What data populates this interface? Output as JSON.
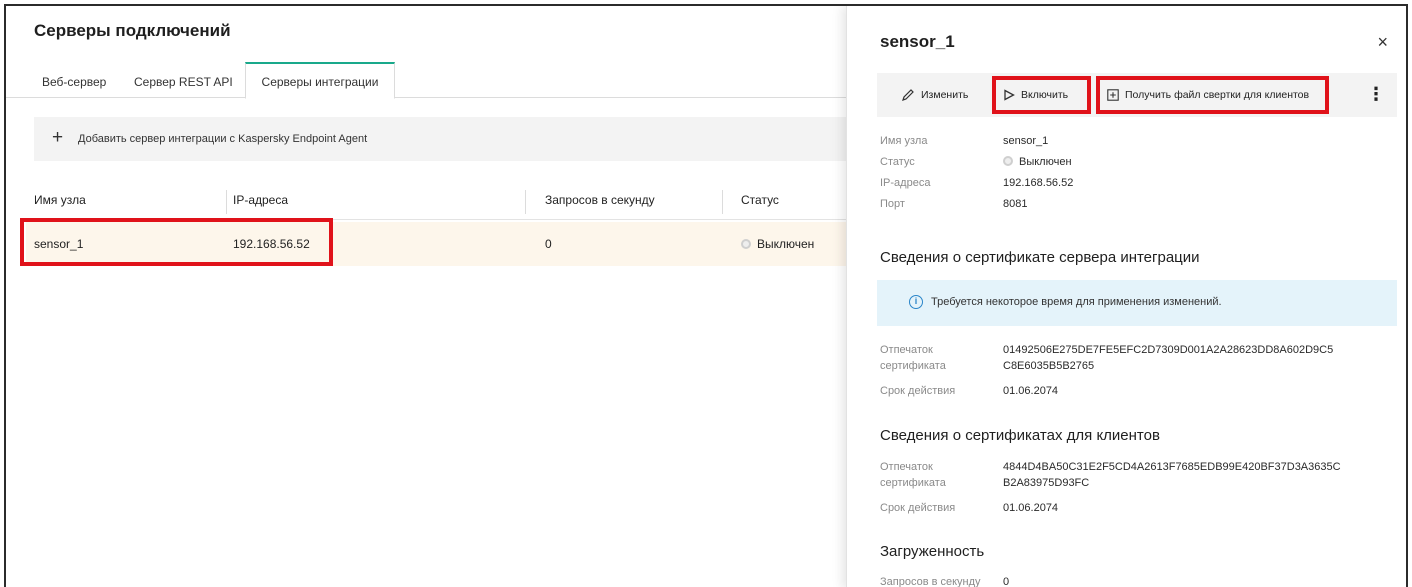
{
  "main": {
    "title": "Серверы подключений",
    "tabs": [
      {
        "label": "Веб-сервер"
      },
      {
        "label": "Сервер REST API"
      },
      {
        "label": "Серверы интеграции",
        "active": true
      }
    ],
    "add_button_label": "Добавить сервер интеграции с Kaspersky Endpoint Agent",
    "table": {
      "columns": [
        "Имя узла",
        "IP-адреса",
        "Запросов в секунду",
        "Статус"
      ],
      "rows": [
        {
          "name": "sensor_1",
          "ip": "192.168.56.52",
          "rps": "0",
          "status": "Выключен"
        }
      ]
    }
  },
  "panel": {
    "title": "sensor_1",
    "close_icon": "×",
    "toolbar": {
      "edit": "Изменить",
      "enable": "Включить",
      "get_file": "Получить файл свертки для клиентов",
      "more_icon": "⋮"
    },
    "details": {
      "host_label": "Имя узла",
      "host_value": "sensor_1",
      "status_label": "Статус",
      "status_value": "Выключен",
      "ip_label": "IP-адреса",
      "ip_value": "192.168.56.52",
      "port_label": "Порт",
      "port_value": "8081"
    },
    "server_cert": {
      "title": "Сведения о сертификате сервера интеграции",
      "info": "Требуется некоторое время для применения изменений.",
      "thumb_label_1": "Отпечаток",
      "thumb_label_2": "сертификата",
      "thumb_value_1": "01492506E275DE7FE5EFC2D7309D001A2A28623DD8A602D9C5",
      "thumb_value_2": "C8E6035B5B2765",
      "valid_label": "Срок действия",
      "valid_value": "01.06.2074"
    },
    "client_cert": {
      "title": "Сведения о сертификатах для клиентов",
      "thumb_label_1": "Отпечаток",
      "thumb_label_2": "сертификата",
      "thumb_value_1": "4844D4BA50C31E2F5CD4A2613F7685EDB99E420BF37D3A3635C",
      "thumb_value_2": "B2A83975D93FC",
      "valid_label": "Срок действия",
      "valid_value": "01.06.2074"
    },
    "load": {
      "title": "Загруженность",
      "rps_label": "Запросов в секунду",
      "rps_value": "0"
    }
  },
  "colors": {
    "accent_tab": "#19a98b",
    "highlight_box": "#e0121a",
    "selected_row": "#fdf6eb",
    "info_bg": "#e4f3fa"
  }
}
